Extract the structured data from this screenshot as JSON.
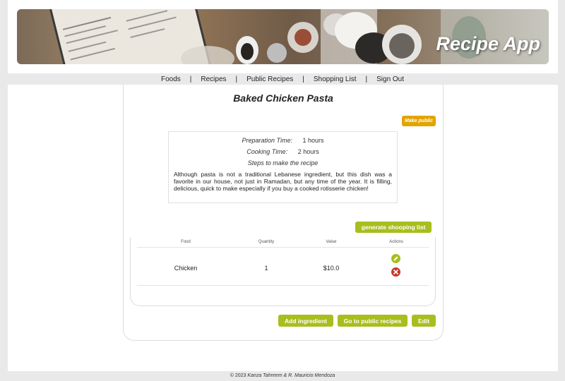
{
  "app": {
    "title": "Recipe App"
  },
  "nav": {
    "items": [
      {
        "label": "Foods"
      },
      {
        "label": "Recipes"
      },
      {
        "label": "Public Recipes"
      },
      {
        "label": "Shopping List"
      },
      {
        "label": "Sign Out"
      }
    ]
  },
  "recipe": {
    "title": "Baked Chicken Pasta",
    "make_public_label": "Make public",
    "prep_label": "Preparation Time:",
    "prep_value": "1 hours",
    "cook_label": "Cooking Time:",
    "cook_value": "2 hours",
    "steps_label": "Steps to make the recipe",
    "description": "Although pasta is not a traditional Lebanese ingredient, but this dish was a favorite in our house, not just in Ramadan, but any time of the year. It is filling, delicious, quick to make especially if you buy a cooked rotisserie chicken!"
  },
  "ingredients": {
    "generate_label": "generate shooping list",
    "headers": {
      "food": "Food",
      "quantity": "Quantity",
      "value": "Value",
      "actions": "Actions"
    },
    "rows": [
      {
        "food": "Chicken",
        "quantity": "1",
        "value": "$10.0"
      }
    ]
  },
  "actions": {
    "add_ingredient": "Add ingredient",
    "go_public": "Go to public recipes",
    "edit": "Edit"
  },
  "footer": {
    "prefix": "© 2023 ",
    "names": "Kanza Tahreem & R. Mauricio Mendoza"
  },
  "colors": {
    "accent_green": "#a8be1e",
    "make_public_orange": "#e2a400",
    "delete_red": "#c8382c"
  },
  "icons": [
    "pencil-icon",
    "close-icon"
  ]
}
